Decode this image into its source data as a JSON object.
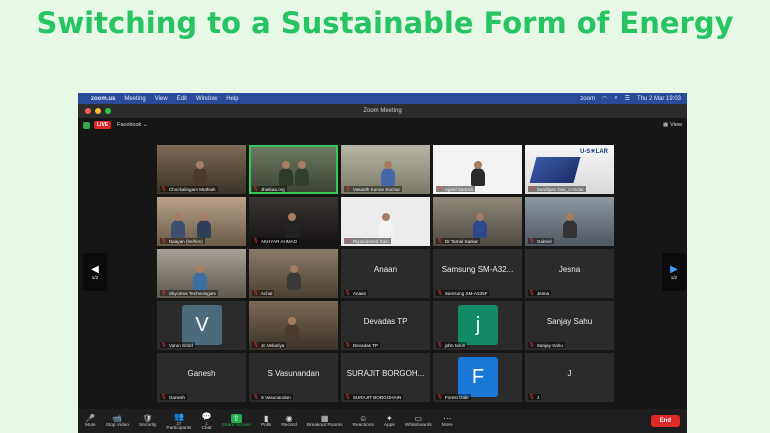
{
  "headline": "Switching to a Sustainable Form of Energy",
  "menubar": {
    "app": "zoom.us",
    "menus": [
      "Meeting",
      "View",
      "Edit",
      "Window",
      "Help"
    ],
    "brand": "zoom",
    "clock": "Thu 2 Mar  19:03"
  },
  "window": {
    "title": "Zoom Meeting"
  },
  "top_strip": {
    "live_label": "LIVE",
    "platform": "Facebook",
    "view_label": "View"
  },
  "page_indicator": {
    "left": "1/2",
    "right": "1/2"
  },
  "participants": [
    {
      "name": "Chockalingam Muthiah",
      "display": "",
      "type": "video"
    },
    {
      "name": "Jhatkaa.org",
      "display": "",
      "type": "video",
      "active": true
    },
    {
      "name": "Vasanth Kumar Kochar",
      "display": "",
      "type": "video"
    },
    {
      "name": "Agnel Samsin",
      "display": "",
      "type": "photo"
    },
    {
      "name": "Sandipan Das_U-Solar",
      "display": "U-S☀LAR",
      "type": "logo"
    },
    {
      "name": "Naayan (he/him)",
      "display": "",
      "type": "video"
    },
    {
      "name": "AKHYAR AHMAD",
      "display": "",
      "type": "video"
    },
    {
      "name": "Riyazahmed Kazi",
      "display": "",
      "type": "photo"
    },
    {
      "name": "Dr Tamal Sarkar",
      "display": "",
      "type": "video"
    },
    {
      "name": "Gabriel",
      "display": "",
      "type": "video"
    },
    {
      "name": "Skycirrus Technologies",
      "display": "",
      "type": "video"
    },
    {
      "name": "Achal",
      "display": "",
      "type": "video"
    },
    {
      "name": "Anaan",
      "display": "Anaan",
      "type": "name"
    },
    {
      "name": "Samsung SM-A325F",
      "display": "Samsung SM-A32...",
      "type": "name"
    },
    {
      "name": "Jesna",
      "display": "Jesna",
      "type": "name"
    },
    {
      "name": "Varun Sood",
      "display": "V",
      "type": "avatar",
      "color": "#4a6b7c"
    },
    {
      "name": "Jc Vekariya",
      "display": "",
      "type": "photo"
    },
    {
      "name": "Devadas TP",
      "display": "Devadas TP",
      "type": "name"
    },
    {
      "name": "john tarun",
      "display": "j",
      "type": "avatar",
      "color": "#138a66"
    },
    {
      "name": "Sanjay Sahu",
      "display": "Sanjay Sahu",
      "type": "name"
    },
    {
      "name": "Ganesh",
      "display": "Ganesh",
      "type": "name"
    },
    {
      "name": "S Vasunandan",
      "display": "S Vasunandan",
      "type": "name"
    },
    {
      "name": "SURAJIT BORGOHAIN",
      "display": "SURAJIT BORGOH...",
      "type": "name"
    },
    {
      "name": "Forest Dale",
      "display": "F",
      "type": "avatar",
      "color": "#1a78d6"
    },
    {
      "name": "J",
      "display": "J",
      "type": "name"
    }
  ],
  "toolbar": [
    {
      "id": "mute",
      "label": "Mute",
      "icon": "🎤"
    },
    {
      "id": "stop-video",
      "label": "Stop Video",
      "icon": "📹"
    },
    {
      "id": "security",
      "label": "Security",
      "icon": "🛡"
    },
    {
      "id": "participants",
      "label": "Participants",
      "icon": "👥",
      "badge": "27"
    },
    {
      "id": "chat",
      "label": "Chat",
      "icon": "💬",
      "badge": "1"
    },
    {
      "id": "share-screen",
      "label": "Share Screen",
      "icon": "⇧"
    },
    {
      "id": "polls",
      "label": "Polls",
      "icon": "▮"
    },
    {
      "id": "record",
      "label": "Record",
      "icon": "◉"
    },
    {
      "id": "breakout-rooms",
      "label": "Breakout Rooms",
      "icon": "▦"
    },
    {
      "id": "reactions",
      "label": "Reactions",
      "icon": "☺"
    },
    {
      "id": "apps",
      "label": "Apps",
      "icon": "✦"
    },
    {
      "id": "whiteboards",
      "label": "Whiteboards",
      "icon": "▭"
    },
    {
      "id": "more",
      "label": "More",
      "icon": "⋯"
    }
  ],
  "end_label": "End",
  "colors": {
    "headline": "#27c463",
    "active_speaker": "#34c759",
    "end": "#e02727",
    "live": "#e02727"
  }
}
